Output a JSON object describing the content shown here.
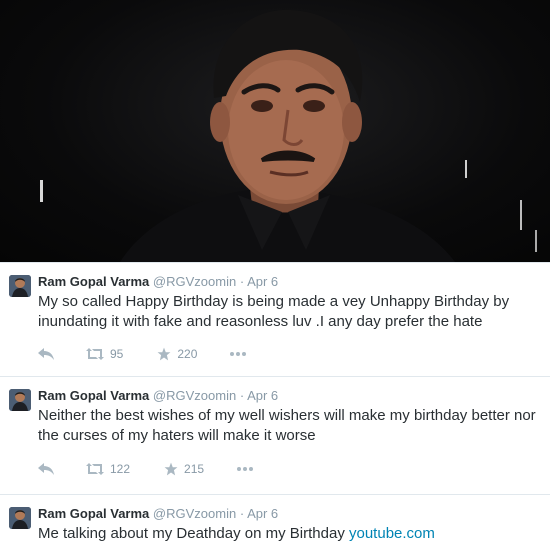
{
  "tweets": [
    {
      "name": "Ram Gopal Varma",
      "handle": "@RGVzoomin",
      "separator": "·",
      "date": "Apr 6",
      "text": "My so called Happy Birthday is being made a vey Unhappy Birthday by inundating it with fake and reasonless luv .I any day prefer the hate",
      "retweets": "95",
      "favorites": "220"
    },
    {
      "name": "Ram Gopal Varma",
      "handle": "@RGVzoomin",
      "separator": "·",
      "date": "Apr 6",
      "text": "Neither the best wishes of my well wishers will make my birthday better nor the curses of my haters will make it worse",
      "retweets": "122",
      "favorites": "215"
    },
    {
      "name": "Ram Gopal Varma",
      "handle": "@RGVzoomin",
      "separator": "·",
      "date": "Apr 6",
      "text": "Me talking about my Deathday on my Birthday",
      "link": "youtube.com"
    }
  ],
  "icons": {
    "reply": "reply-arrow-icon",
    "retweet": "retweet-icon",
    "favorite": "star-icon",
    "more": "more-dots-icon"
  },
  "colors": {
    "link": "#0084b4",
    "meta": "#8899a6",
    "text": "#292f33",
    "action_icon": "#aab8c2"
  }
}
